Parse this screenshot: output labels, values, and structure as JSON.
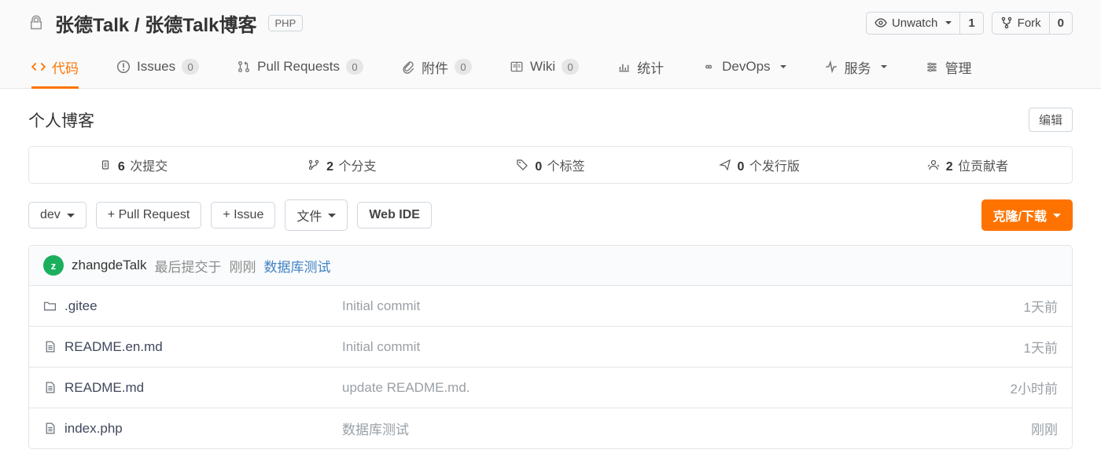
{
  "header": {
    "owner": "张德Talk",
    "repo": "张德Talk博客",
    "language": "PHP",
    "watch_label": "Unwatch",
    "watch_count": "1",
    "fork_label": "Fork",
    "fork_count": "0"
  },
  "tabs": {
    "code": "代码",
    "issues": "Issues",
    "issues_count": "0",
    "prs": "Pull Requests",
    "prs_count": "0",
    "attachments": "附件",
    "attachments_count": "0",
    "wiki": "Wiki",
    "wiki_count": "0",
    "stats": "统计",
    "devops": "DevOps",
    "services": "服务",
    "manage": "管理"
  },
  "description": {
    "text": "个人博客",
    "edit": "编辑"
  },
  "stats": {
    "commits_n": "6",
    "commits": "次提交",
    "branches_n": "2",
    "branches": "个分支",
    "tags_n": "0",
    "tags": "个标签",
    "releases_n": "0",
    "releases": "个发行版",
    "contributors_n": "2",
    "contributors": "位贡献者"
  },
  "toolbar": {
    "branch": "dev",
    "pr": "+ Pull Request",
    "issue": "+ Issue",
    "files": "文件",
    "webide": "Web IDE",
    "clone": "克隆/下载"
  },
  "last_commit": {
    "avatar_letter": "z",
    "author": "zhangdeTalk",
    "prefix": "最后提交于",
    "when": "刚刚",
    "message": "数据库测试"
  },
  "files": [
    {
      "name": ".gitee",
      "type": "dir",
      "msg": "Initial commit",
      "when": "1天前"
    },
    {
      "name": "README.en.md",
      "type": "file",
      "msg": "Initial commit",
      "when": "1天前"
    },
    {
      "name": "README.md",
      "type": "file",
      "msg": "update README.md.",
      "when": "2小时前"
    },
    {
      "name": "index.php",
      "type": "file",
      "msg": "数据库测试",
      "when": "刚刚"
    }
  ]
}
